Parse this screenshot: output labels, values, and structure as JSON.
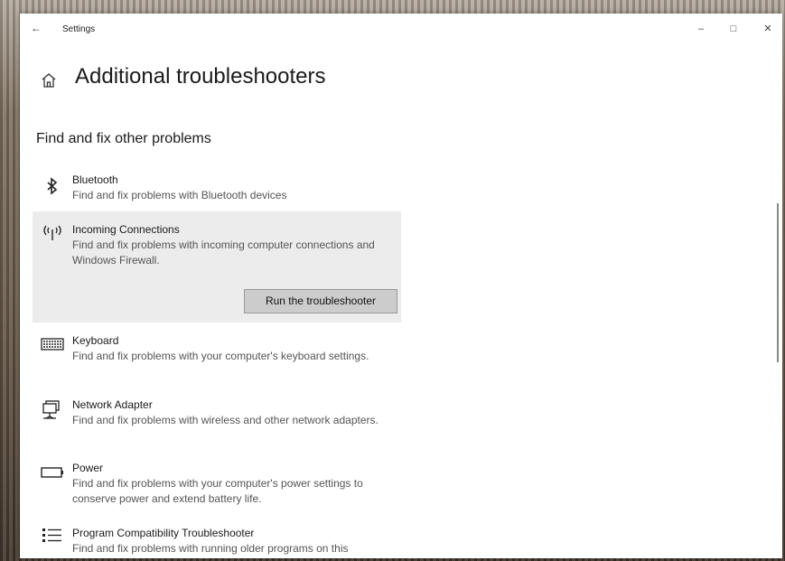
{
  "window": {
    "back_glyph": "←",
    "title": "Settings",
    "minimize_glyph": "–",
    "maximize_glyph": "□",
    "close_glyph": "✕"
  },
  "header": {
    "title": "Additional troubleshooters"
  },
  "section": {
    "title": "Find and fix other problems"
  },
  "items": [
    {
      "name": "Bluetooth",
      "desc": "Find and fix problems with Bluetooth devices",
      "icon": "bluetooth-icon"
    },
    {
      "name": "Incoming Connections",
      "desc": "Find and fix problems with incoming computer connections and Windows Firewall.",
      "icon": "antenna-icon",
      "button": "Run the troubleshooter"
    },
    {
      "name": "Keyboard",
      "desc": "Find and fix problems with your computer's keyboard settings.",
      "icon": "keyboard-icon"
    },
    {
      "name": "Network Adapter",
      "desc": "Find and fix problems with wireless and other network adapters.",
      "icon": "network-adapter-icon"
    },
    {
      "name": "Power",
      "desc": "Find and fix problems with your computer's power settings to conserve power and extend battery life.",
      "icon": "battery-icon"
    },
    {
      "name": "Program Compatibility Troubleshooter",
      "desc": "Find and fix problems with running older programs on this",
      "icon": "list-icon"
    }
  ],
  "colors": {
    "selected_bg": "#ececec",
    "button_bg": "#cccccc"
  }
}
